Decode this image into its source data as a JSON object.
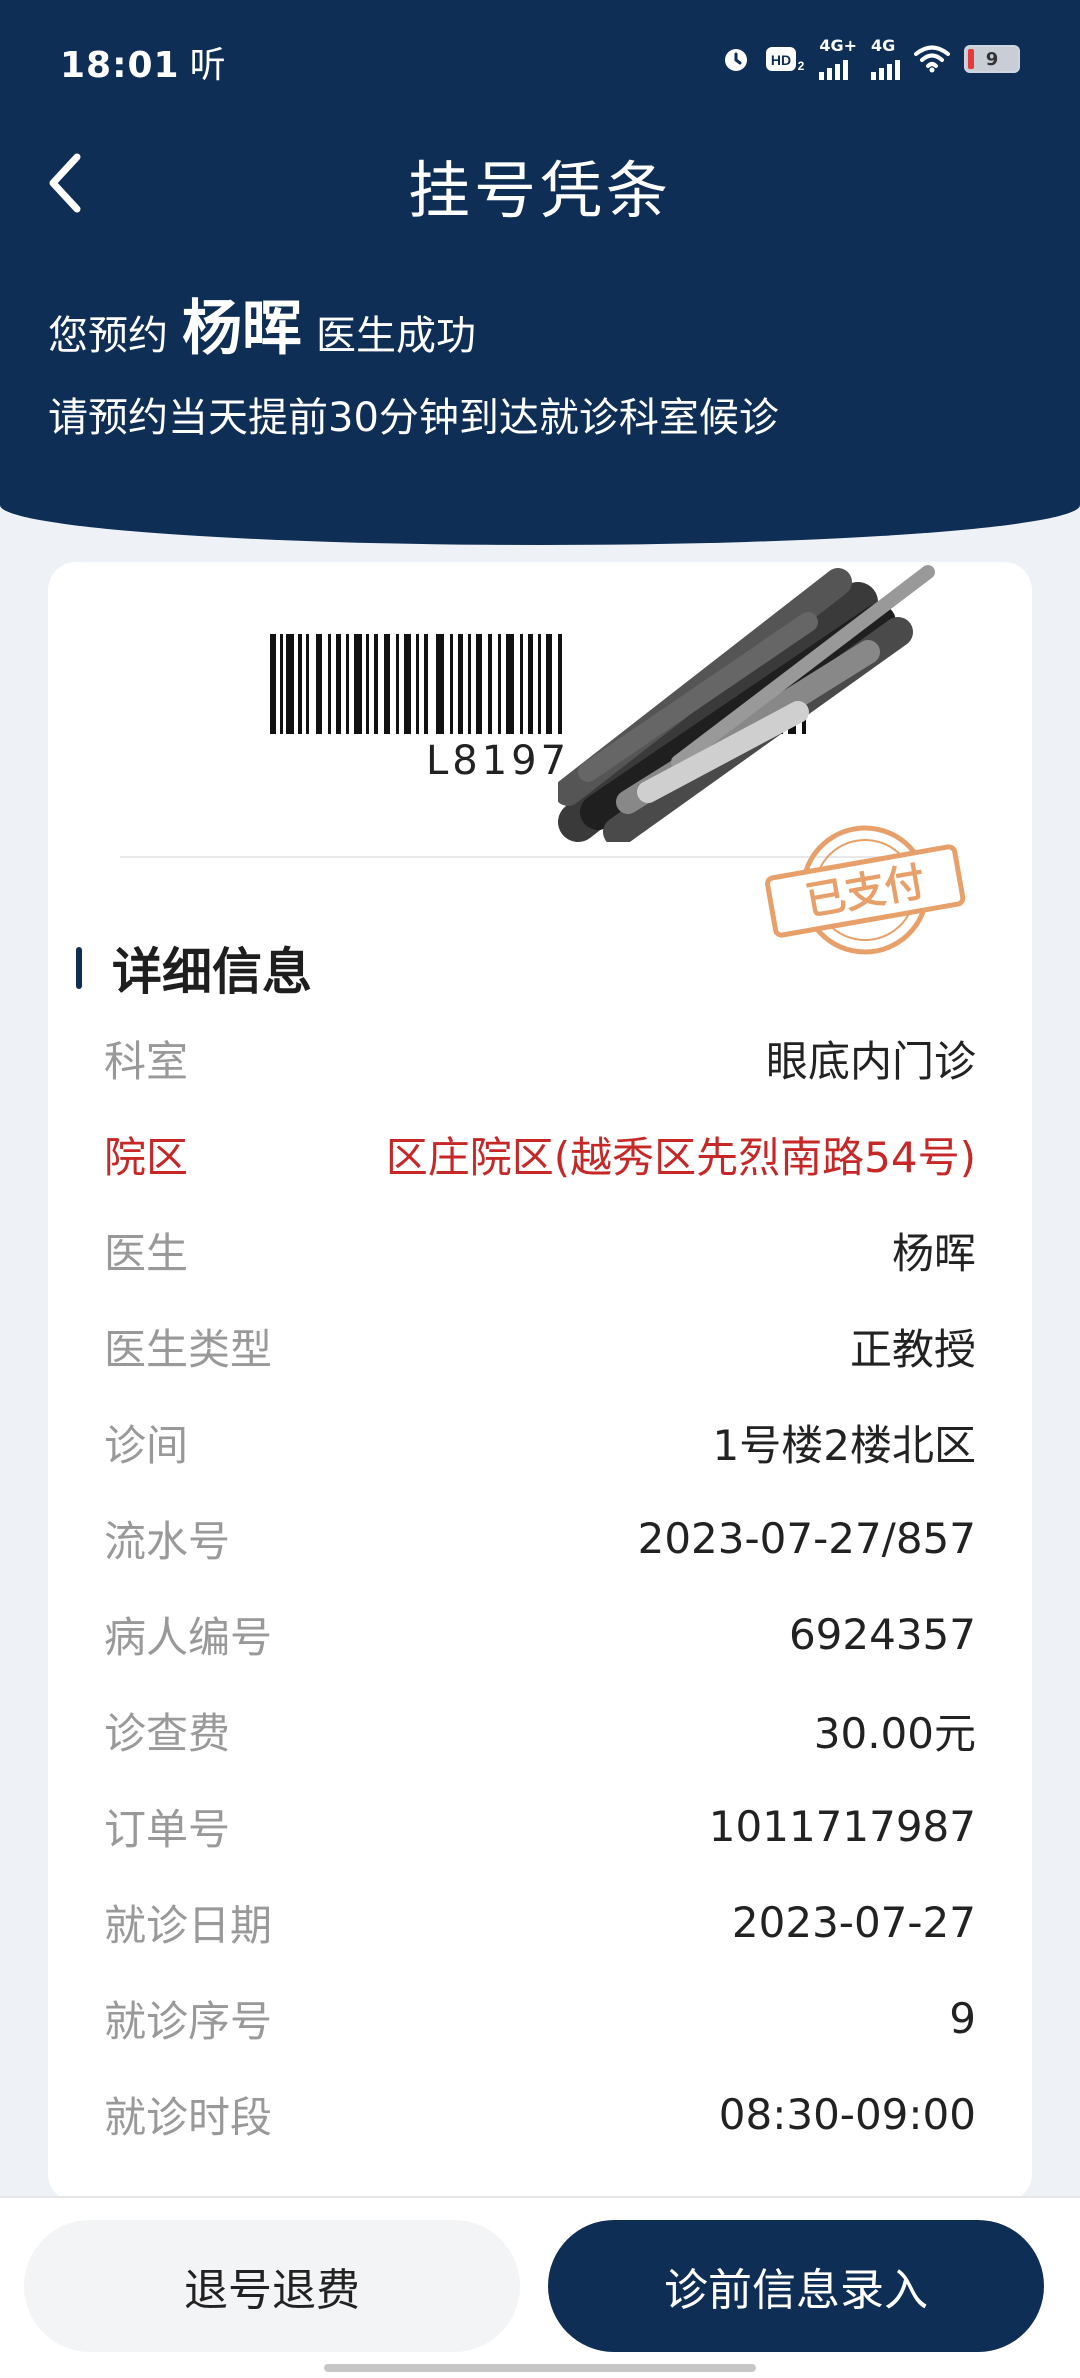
{
  "status_bar": {
    "time": "18:01",
    "ting": "听",
    "hd": "HD",
    "net1": "4G+",
    "net2": "4G",
    "battery": "9"
  },
  "nav": {
    "title": "挂号凭条"
  },
  "header": {
    "msg_prefix": "您预约",
    "doctor": "杨晖",
    "msg_suffix": "医生成功",
    "notice": "请预约当天提前30分钟到达就诊科室候诊"
  },
  "barcode": {
    "text": "L81​97"
  },
  "stamp": {
    "text": "已支付"
  },
  "details": {
    "title": "详细信息",
    "rows": [
      {
        "label": "科室",
        "value": "眼底内门诊"
      },
      {
        "label": "院区",
        "value": "区庄院区(越秀区先烈南路54号)"
      },
      {
        "label": "医生",
        "value": "杨晖"
      },
      {
        "label": "医生类型",
        "value": "正教授"
      },
      {
        "label": "诊间",
        "value": "1号楼2楼北区"
      },
      {
        "label": "流水号",
        "value": "2023-07-27/857"
      },
      {
        "label": "病人编号",
        "value": "6924357"
      },
      {
        "label": "诊查费",
        "value": "30.00元"
      },
      {
        "label": "订单号",
        "value": "1011717987"
      },
      {
        "label": "就诊日期",
        "value": "2023-07-27"
      },
      {
        "label": "就诊序号",
        "value": "9"
      },
      {
        "label": "就诊时段",
        "value": "08:30-09:00"
      }
    ]
  },
  "actions": {
    "refund": "退号退费",
    "pre_info": "诊前信息录入"
  },
  "colors": {
    "primary": "#0e2e56",
    "highlight_red": "#c62828",
    "stamp_orange": "#e8a06a"
  }
}
